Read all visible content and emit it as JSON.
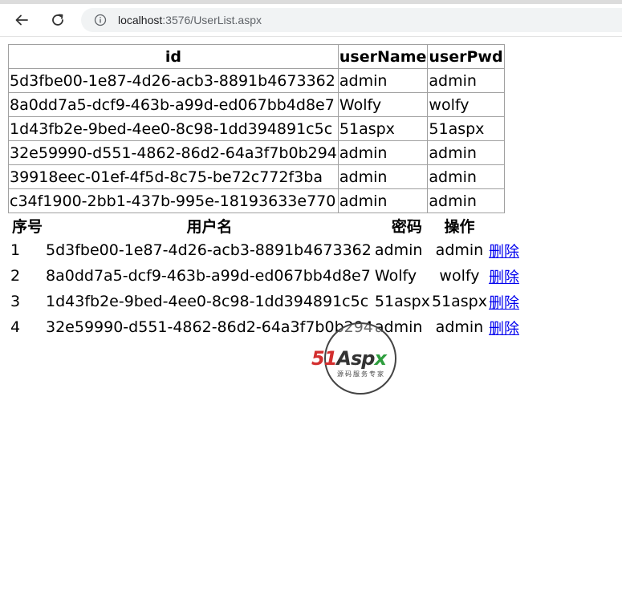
{
  "browser": {
    "url_host": "localhost",
    "url_path": ":3576/UserList.aspx"
  },
  "gridview": {
    "headers": [
      "id",
      "userName",
      "userPwd"
    ],
    "rows": [
      [
        "5d3fbe00-1e87-4d26-acb3-8891b4673362",
        "admin",
        "admin"
      ],
      [
        "8a0dd7a5-dcf9-463b-a99d-ed067bb4d8e7",
        "Wolfy",
        "wolfy"
      ],
      [
        "1d43fb2e-9bed-4ee0-8c98-1dd394891c5c",
        "51aspx",
        "51aspx"
      ],
      [
        "32e59990-d551-4862-86d2-64a3f7b0b294",
        "admin",
        "admin"
      ],
      [
        "39918eec-01ef-4f5d-8c75-be72c772f3ba",
        "admin",
        "admin"
      ],
      [
        "c34f1900-2bb1-437b-995e-18193633e770",
        "admin",
        "admin"
      ]
    ]
  },
  "repeater": {
    "headers": [
      "序号",
      "用户名",
      "密码",
      "操作"
    ],
    "rows": [
      {
        "num": "1",
        "id": "5d3fbe00-1e87-4d26-acb3-8891b4673362",
        "name": "admin",
        "pwd": "admin",
        "action": "删除"
      },
      {
        "num": "2",
        "id": "8a0dd7a5-dcf9-463b-a99d-ed067bb4d8e7",
        "name": "Wolfy",
        "pwd": "wolfy",
        "action": "删除"
      },
      {
        "num": "3",
        "id": "1d43fb2e-9bed-4ee0-8c98-1dd394891c5c",
        "name": "51aspx",
        "pwd": "51aspx",
        "action": "删除"
      },
      {
        "num": "4",
        "id": "32e59990-d551-4862-86d2-64a3f7b0b294",
        "name": "admin",
        "pwd": "admin",
        "action": "删除"
      }
    ]
  },
  "watermark": {
    "logo_part1": "51",
    "logo_part2": "Asp",
    "logo_part3": "x",
    "tagline": "源码服务专家"
  },
  "colors": {
    "link": "#0000ee",
    "logo_red": "#d32f2f",
    "logo_green": "#2e9e3e"
  },
  "icons": [
    "back-arrow-icon",
    "reload-icon",
    "info-icon"
  ]
}
